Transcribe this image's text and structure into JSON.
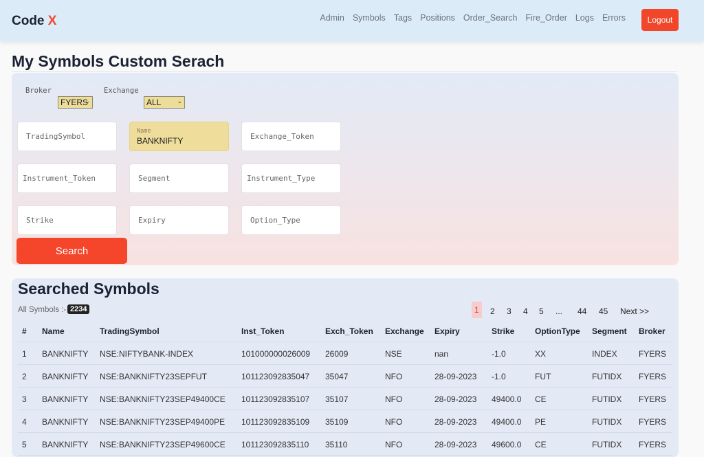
{
  "navbar": {
    "brand": "Code",
    "brand_accent": "X",
    "links": [
      "Admin",
      "Symbols",
      "Tags",
      "Positions",
      "Order_Search",
      "Fire_Order",
      "Logs",
      "Errors"
    ],
    "logout_label": "Logout"
  },
  "colors": {
    "accent": "#f2462a",
    "navbar_bg": "#dcebf8",
    "highlight": "#efdd9c"
  },
  "search": {
    "title": "My Symbols Custom Serach",
    "broker_label": "Broker",
    "broker_value": "FYERS",
    "exchange_label": "Exchange",
    "exchange_value": "ALL",
    "fields": {
      "trading_symbol": "TradingSymbol",
      "name_label": "Name",
      "name_value": "BANKNIFTY",
      "exchange_token": "Exchange_Token",
      "instrument_token": "Instrument_Token",
      "segment": "Segment",
      "instrument_type": "Instrument_Type",
      "strike": "Strike",
      "expiry": "Expiry",
      "option_type": "Option_Type"
    },
    "search_button": "Search"
  },
  "results": {
    "title": "Searched Symbols",
    "count_label": "All Symbols :-",
    "count": "2234",
    "pagination": [
      "1",
      "2",
      "3",
      "4",
      "5",
      "...",
      "44",
      "45",
      "Next >>"
    ],
    "columns": [
      "#",
      "Name",
      "TradingSymbol",
      "Inst_Token",
      "Exch_Token",
      "Exchange",
      "Expiry",
      "Strike",
      "OptionType",
      "Segment",
      "Broker"
    ],
    "rows": [
      [
        "1",
        "BANKNIFTY",
        "NSE:NIFTYBANK-INDEX",
        "101000000026009",
        "26009",
        "NSE",
        "nan",
        "-1.0",
        "XX",
        "INDEX",
        "FYERS"
      ],
      [
        "2",
        "BANKNIFTY",
        "NSE:BANKNIFTY23SEPFUT",
        "101123092835047",
        "35047",
        "NFO",
        "28-09-2023",
        "-1.0",
        "FUT",
        "FUTIDX",
        "FYERS"
      ],
      [
        "3",
        "BANKNIFTY",
        "NSE:BANKNIFTY23SEP49400CE",
        "101123092835107",
        "35107",
        "NFO",
        "28-09-2023",
        "49400.0",
        "CE",
        "FUTIDX",
        "FYERS"
      ],
      [
        "4",
        "BANKNIFTY",
        "NSE:BANKNIFTY23SEP49400PE",
        "101123092835109",
        "35109",
        "NFO",
        "28-09-2023",
        "49400.0",
        "PE",
        "FUTIDX",
        "FYERS"
      ],
      [
        "5",
        "BANKNIFTY",
        "NSE:BANKNIFTY23SEP49600CE",
        "101123092835110",
        "35110",
        "NFO",
        "28-09-2023",
        "49600.0",
        "CE",
        "FUTIDX",
        "FYERS"
      ]
    ]
  }
}
